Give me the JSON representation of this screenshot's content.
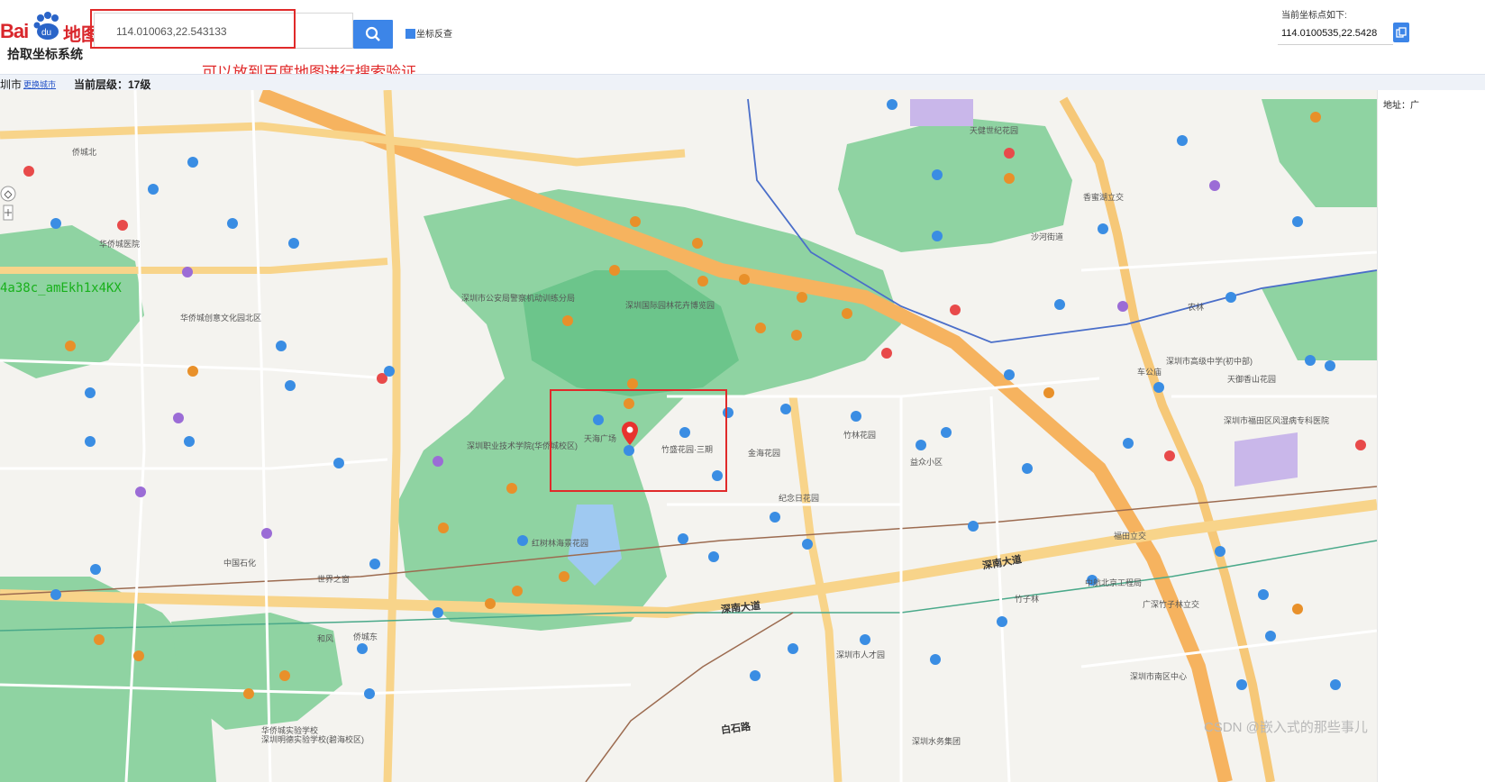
{
  "header": {
    "logo_prefix": "Bai",
    "logo_paw": "du",
    "logo_cn": "地图",
    "logo_subtitle": "拾取坐标系统",
    "search_value": "114.010063,22.543133",
    "checkbox_label": "坐标反查",
    "note": "可以放到百度地图进行搜索验证",
    "coord_title": "当前坐标点如下:",
    "coord_value": "114.0100535,22.5428"
  },
  "infobar": {
    "city": "圳市",
    "switch_city": "更换城市",
    "level": "当前层级：17级"
  },
  "map": {
    "overlay_text": "4a38c_amEkh1x4KX",
    "watermark": "CSDN @嵌入式的那些事儿",
    "address_label": "地址：广",
    "roads": {
      "shennan_1": "深南大道",
      "shennan_2": "深南大道",
      "baishi": "白石路",
      "hongkou": "深圳水务集团"
    },
    "labels": [
      "深圳市公安局警察机动训练分局",
      "深圳国际园林花卉博览园",
      "天海广场",
      "竹盛花园·三期",
      "华侨城医院",
      "华侨城创意文化园北区",
      "中国石化",
      "深圳市人才园",
      "竹子林",
      "福田立交",
      "农林",
      "侨城北",
      "侨城东",
      "和风",
      "车公庙",
      "深圳市南区中心",
      "广深竹子林立交",
      "香蜜湖立交",
      "红树林海景花园",
      "华侨城实验学校",
      "深圳明德实验学校(碧海校区)",
      "深圳职业技术学院(华侨城校区)",
      "世界之窗",
      "中航北京工程局",
      "纪念日花园",
      "金海花园",
      "竹林花园",
      "益众小区",
      "深圳市高级中学(初中部)",
      "深圳市福田区风湿病专科医院",
      "天健世纪花园",
      "天御香山花园",
      "沙河街道"
    ]
  },
  "colors": {
    "accent": "#3c85e8",
    "highlight": "#e02a2a",
    "park": "#6cc58b",
    "highway": "#f6b35f",
    "road": "#ffffff"
  }
}
